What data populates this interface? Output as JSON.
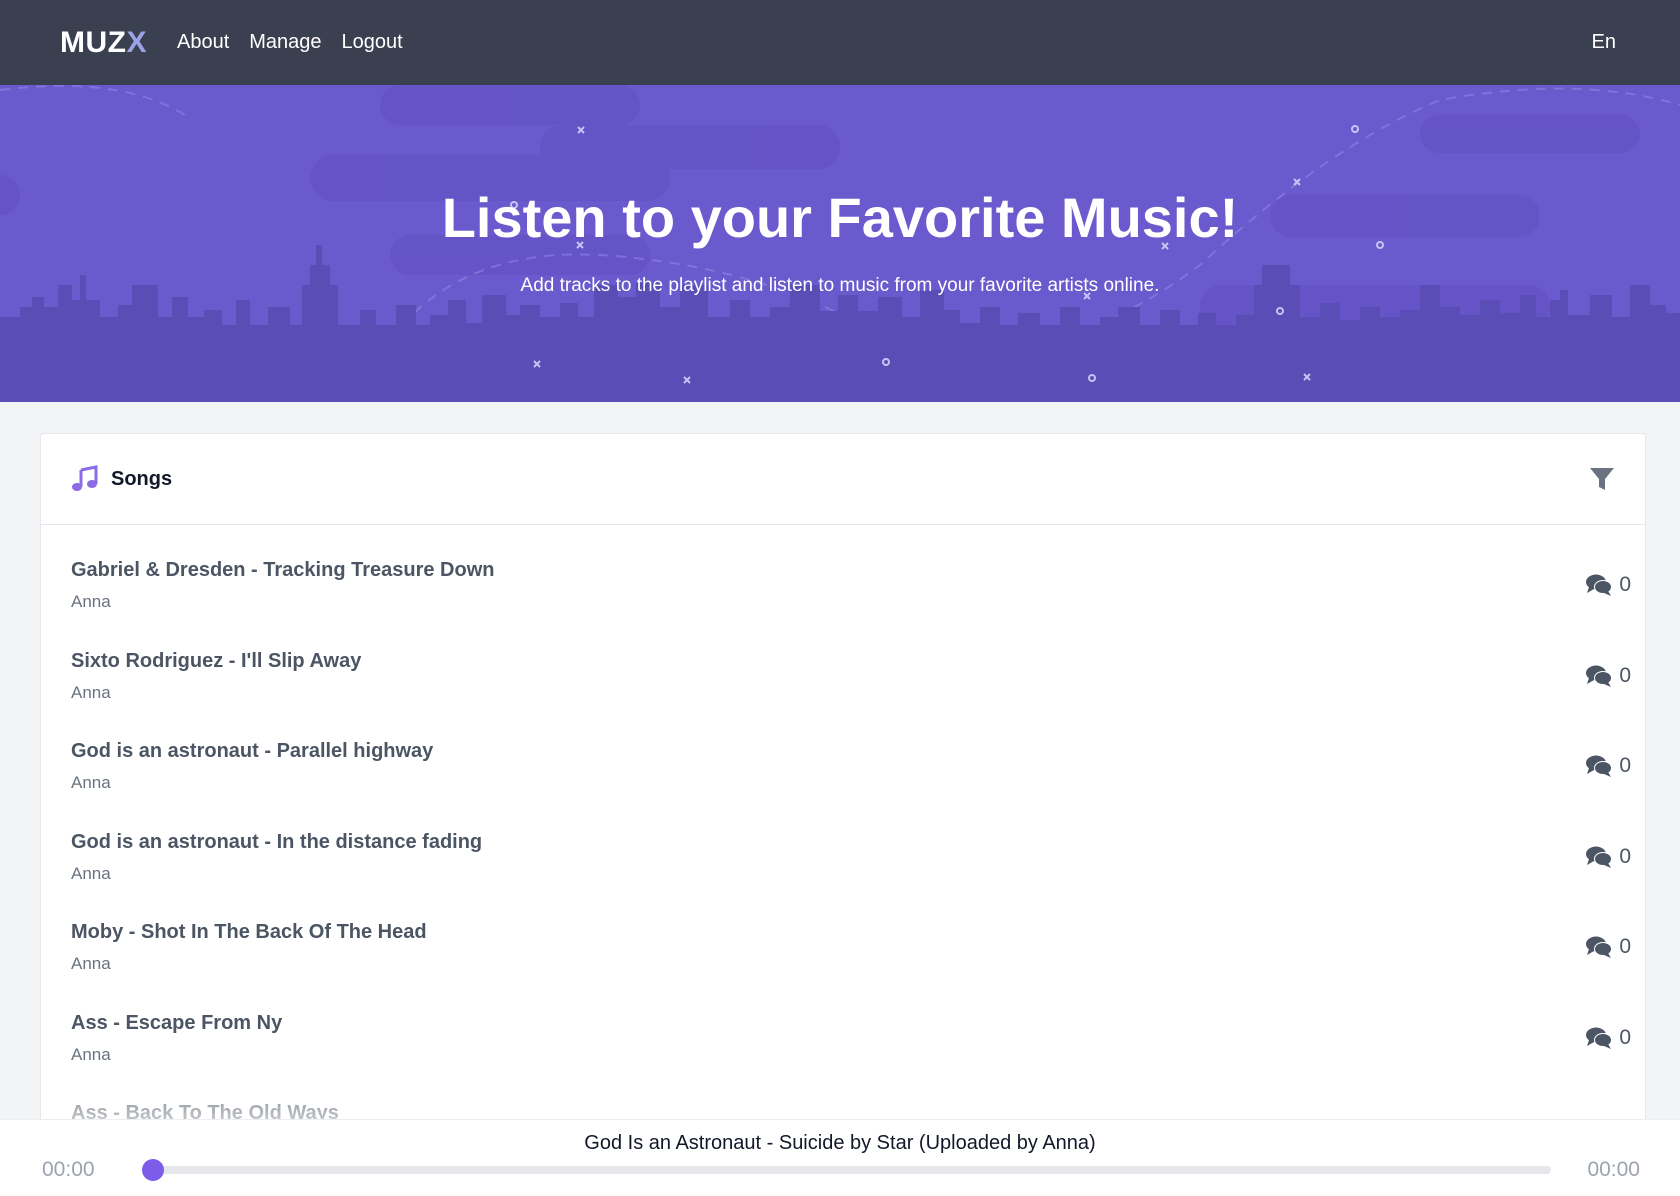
{
  "navbar": {
    "brand_main": "MUZ",
    "brand_accent": "X",
    "links": [
      "About",
      "Manage",
      "Logout"
    ],
    "language": "En"
  },
  "hero": {
    "title": "Listen to your Favorite Music!",
    "subtitle": "Add tracks to the playlist and listen to music from your favorite artists online."
  },
  "songs_card": {
    "header_icon": "music-note-icon",
    "title": "Songs",
    "filter_icon": "filter-icon",
    "comment_icon": "comments-icon",
    "items": [
      {
        "title": "Gabriel & Dresden - Tracking Treasure Down",
        "artist": "Anna",
        "comments": "0"
      },
      {
        "title": "Sixto Rodriguez - I'll Slip Away",
        "artist": "Anna",
        "comments": "0"
      },
      {
        "title": "God is an astronaut - Parallel highway",
        "artist": "Anna",
        "comments": "0"
      },
      {
        "title": "God is an astronaut - In the distance fading",
        "artist": "Anna",
        "comments": "0"
      },
      {
        "title": "Moby - Shot In The Back Of The Head",
        "artist": "Anna",
        "comments": "0"
      },
      {
        "title": "Ass - Escape From Ny",
        "artist": "Anna",
        "comments": "0"
      },
      {
        "title": "Ass - Back To The Old Ways",
        "artist": "",
        "comments": ""
      }
    ]
  },
  "player": {
    "now_playing": "God Is an Astronaut - Suicide by Star (Uploaded by Anna)",
    "current_time": "00:00",
    "duration": "00:00",
    "progress": 0
  },
  "colors": {
    "navbar_bg": "#3b4050",
    "hero_bg": "#6a5acd",
    "accent": "#7c5ce8",
    "brand_accent": "#9aa3e8"
  }
}
